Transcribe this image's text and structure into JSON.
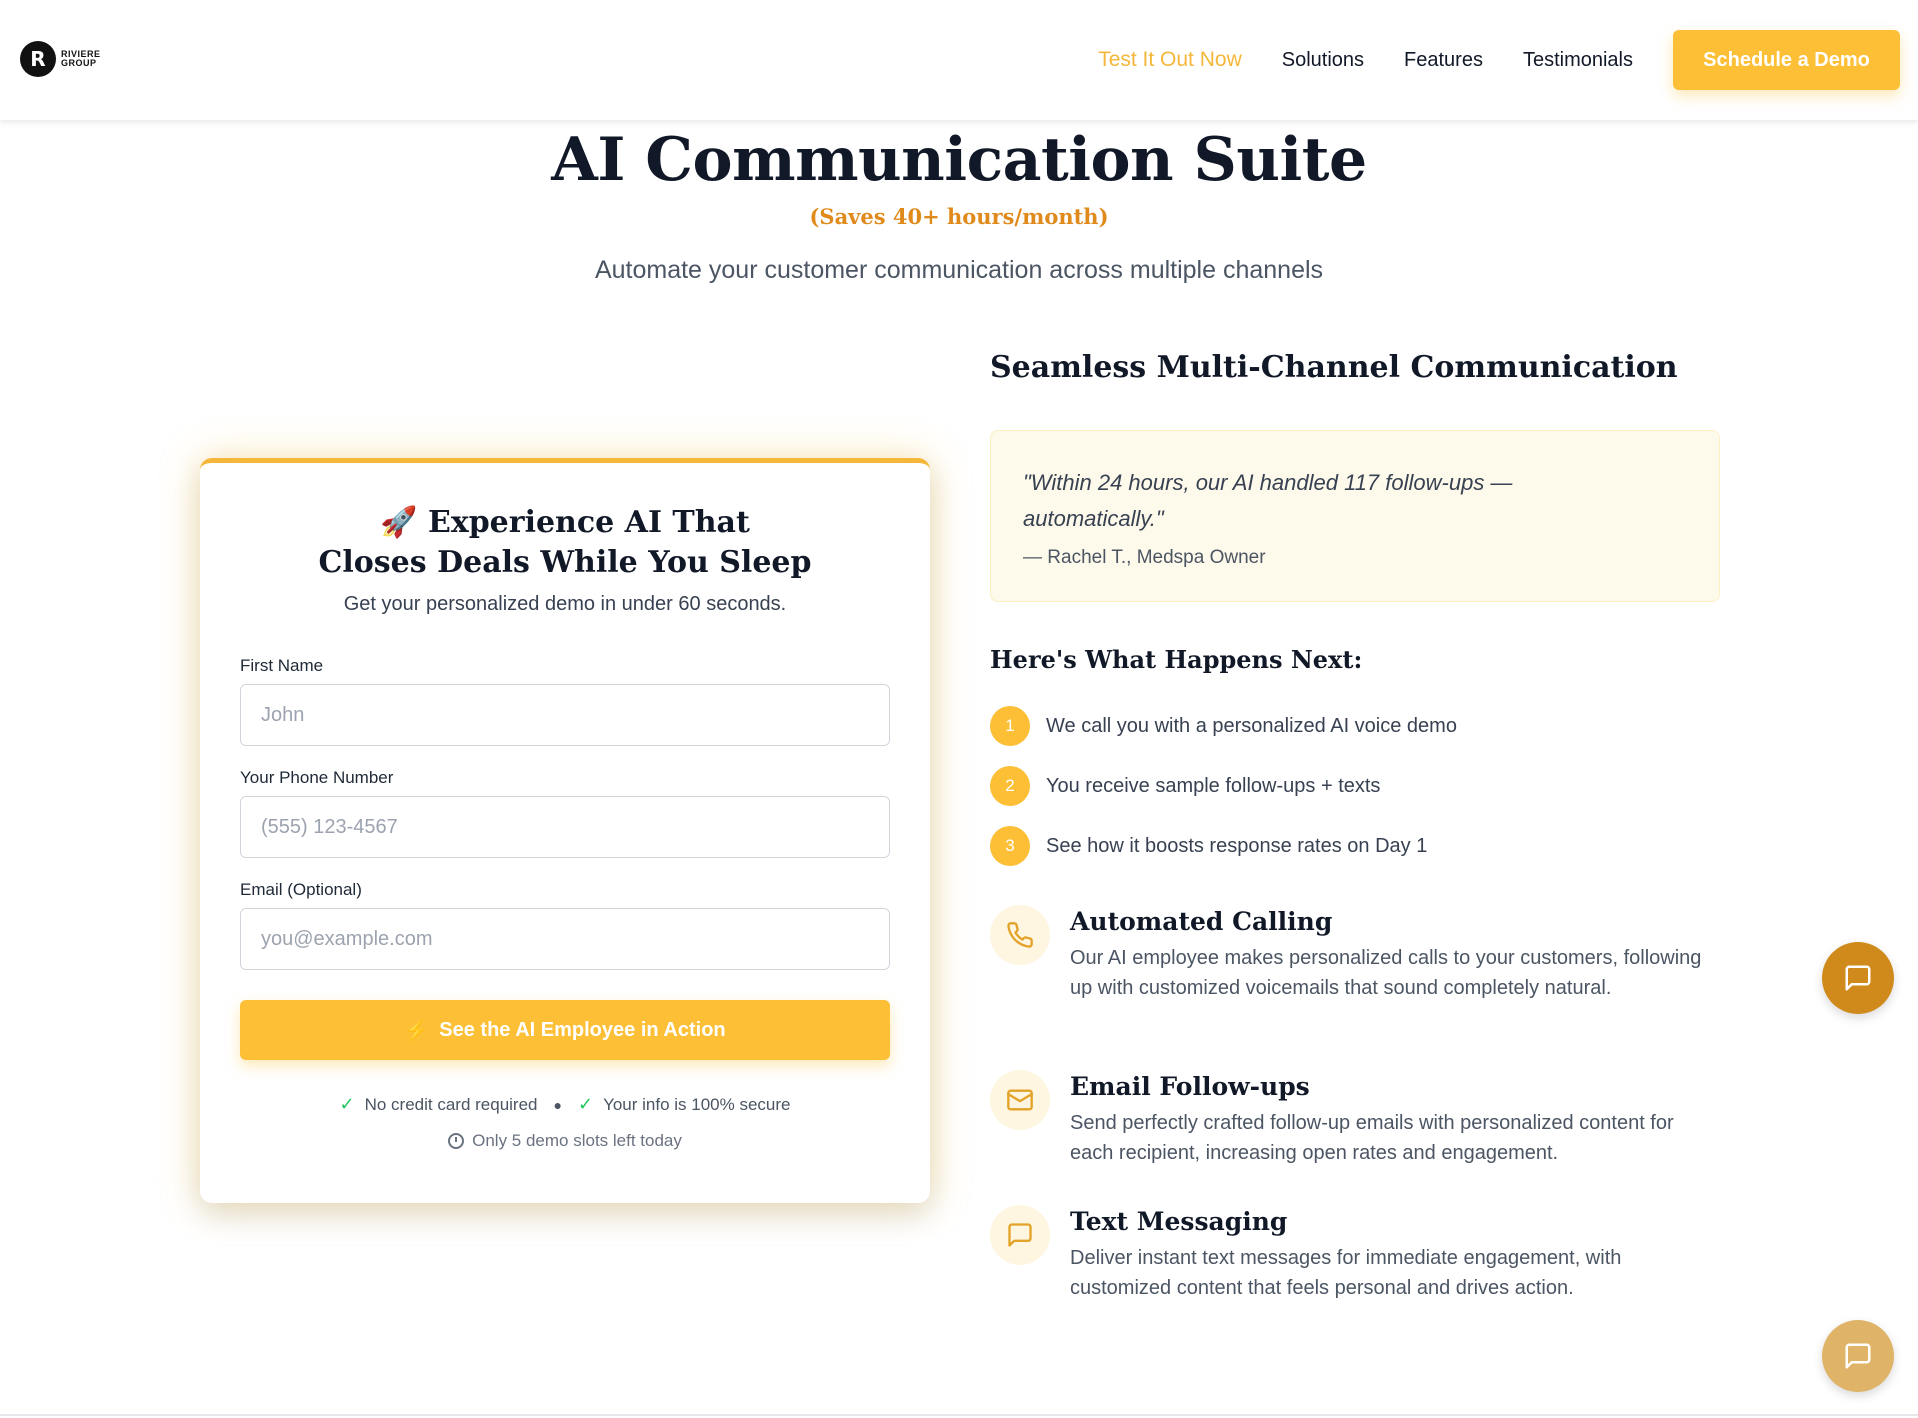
{
  "header": {
    "logo_letter": "R",
    "logo_name_1": "RIVIERE",
    "logo_name_2": "GROUP",
    "nav": [
      {
        "label": "Test It Out Now"
      },
      {
        "label": "Solutions"
      },
      {
        "label": "Features"
      },
      {
        "label": "Testimonials"
      }
    ],
    "cta_label": "Schedule a Demo"
  },
  "hero": {
    "title": "AI Communication Suite",
    "subtitle": "(Saves 40+ hours/month)",
    "description": "Automate your customer communication across multiple channels"
  },
  "form": {
    "title_emoji": "🚀",
    "title_line1": "Experience AI That",
    "title_line2": "Closes Deals While You Sleep",
    "subtitle": "Get your personalized demo in under 60 seconds.",
    "fields": [
      {
        "label": "First Name",
        "placeholder": "John",
        "value": ""
      },
      {
        "label": "Your Phone Number",
        "placeholder": "(555) 123-4567",
        "value": ""
      },
      {
        "label": "Email (Optional)",
        "placeholder": "you@example.com",
        "value": ""
      }
    ],
    "submit_label": "See the AI Employee in Action",
    "trust_1": "No credit card required",
    "trust_2": "Your info is 100% secure",
    "slots_text": "Only 5 demo slots left today"
  },
  "right": {
    "section_title": "Seamless Multi-Channel Communication",
    "quote": "\"Within 24 hours, our AI handled 117 follow-ups — automatically.\"",
    "quote_author": "— Rachel T., Medspa Owner",
    "next_title": "Here's What Happens Next:",
    "steps": [
      {
        "num": "1",
        "text": "We call you with a personalized AI voice demo"
      },
      {
        "num": "2",
        "text": "You receive sample follow-ups + texts"
      },
      {
        "num": "3",
        "text": "See how it boosts response rates on Day 1"
      }
    ],
    "features": [
      {
        "icon": "phone-icon",
        "title": "Automated Calling",
        "desc": "Our AI employee makes personalized calls to your customers, following up with customized voicemails that sound completely natural."
      },
      {
        "icon": "mail-icon",
        "title": "Email Follow-ups",
        "desc": "Send perfectly crafted follow-up emails with personalized content for each recipient, increasing open rates and engagement."
      },
      {
        "icon": "message-icon",
        "title": "Text Messaging",
        "desc": "Deliver instant text messages for immediate engagement, with customized content that feels personal and drives action."
      }
    ]
  },
  "colors": {
    "accent": "#fdbf35",
    "accent_dark": "#cf8a1b",
    "subtitle_orange": "#e08a1c",
    "quote_bg": "#fefaeb"
  }
}
